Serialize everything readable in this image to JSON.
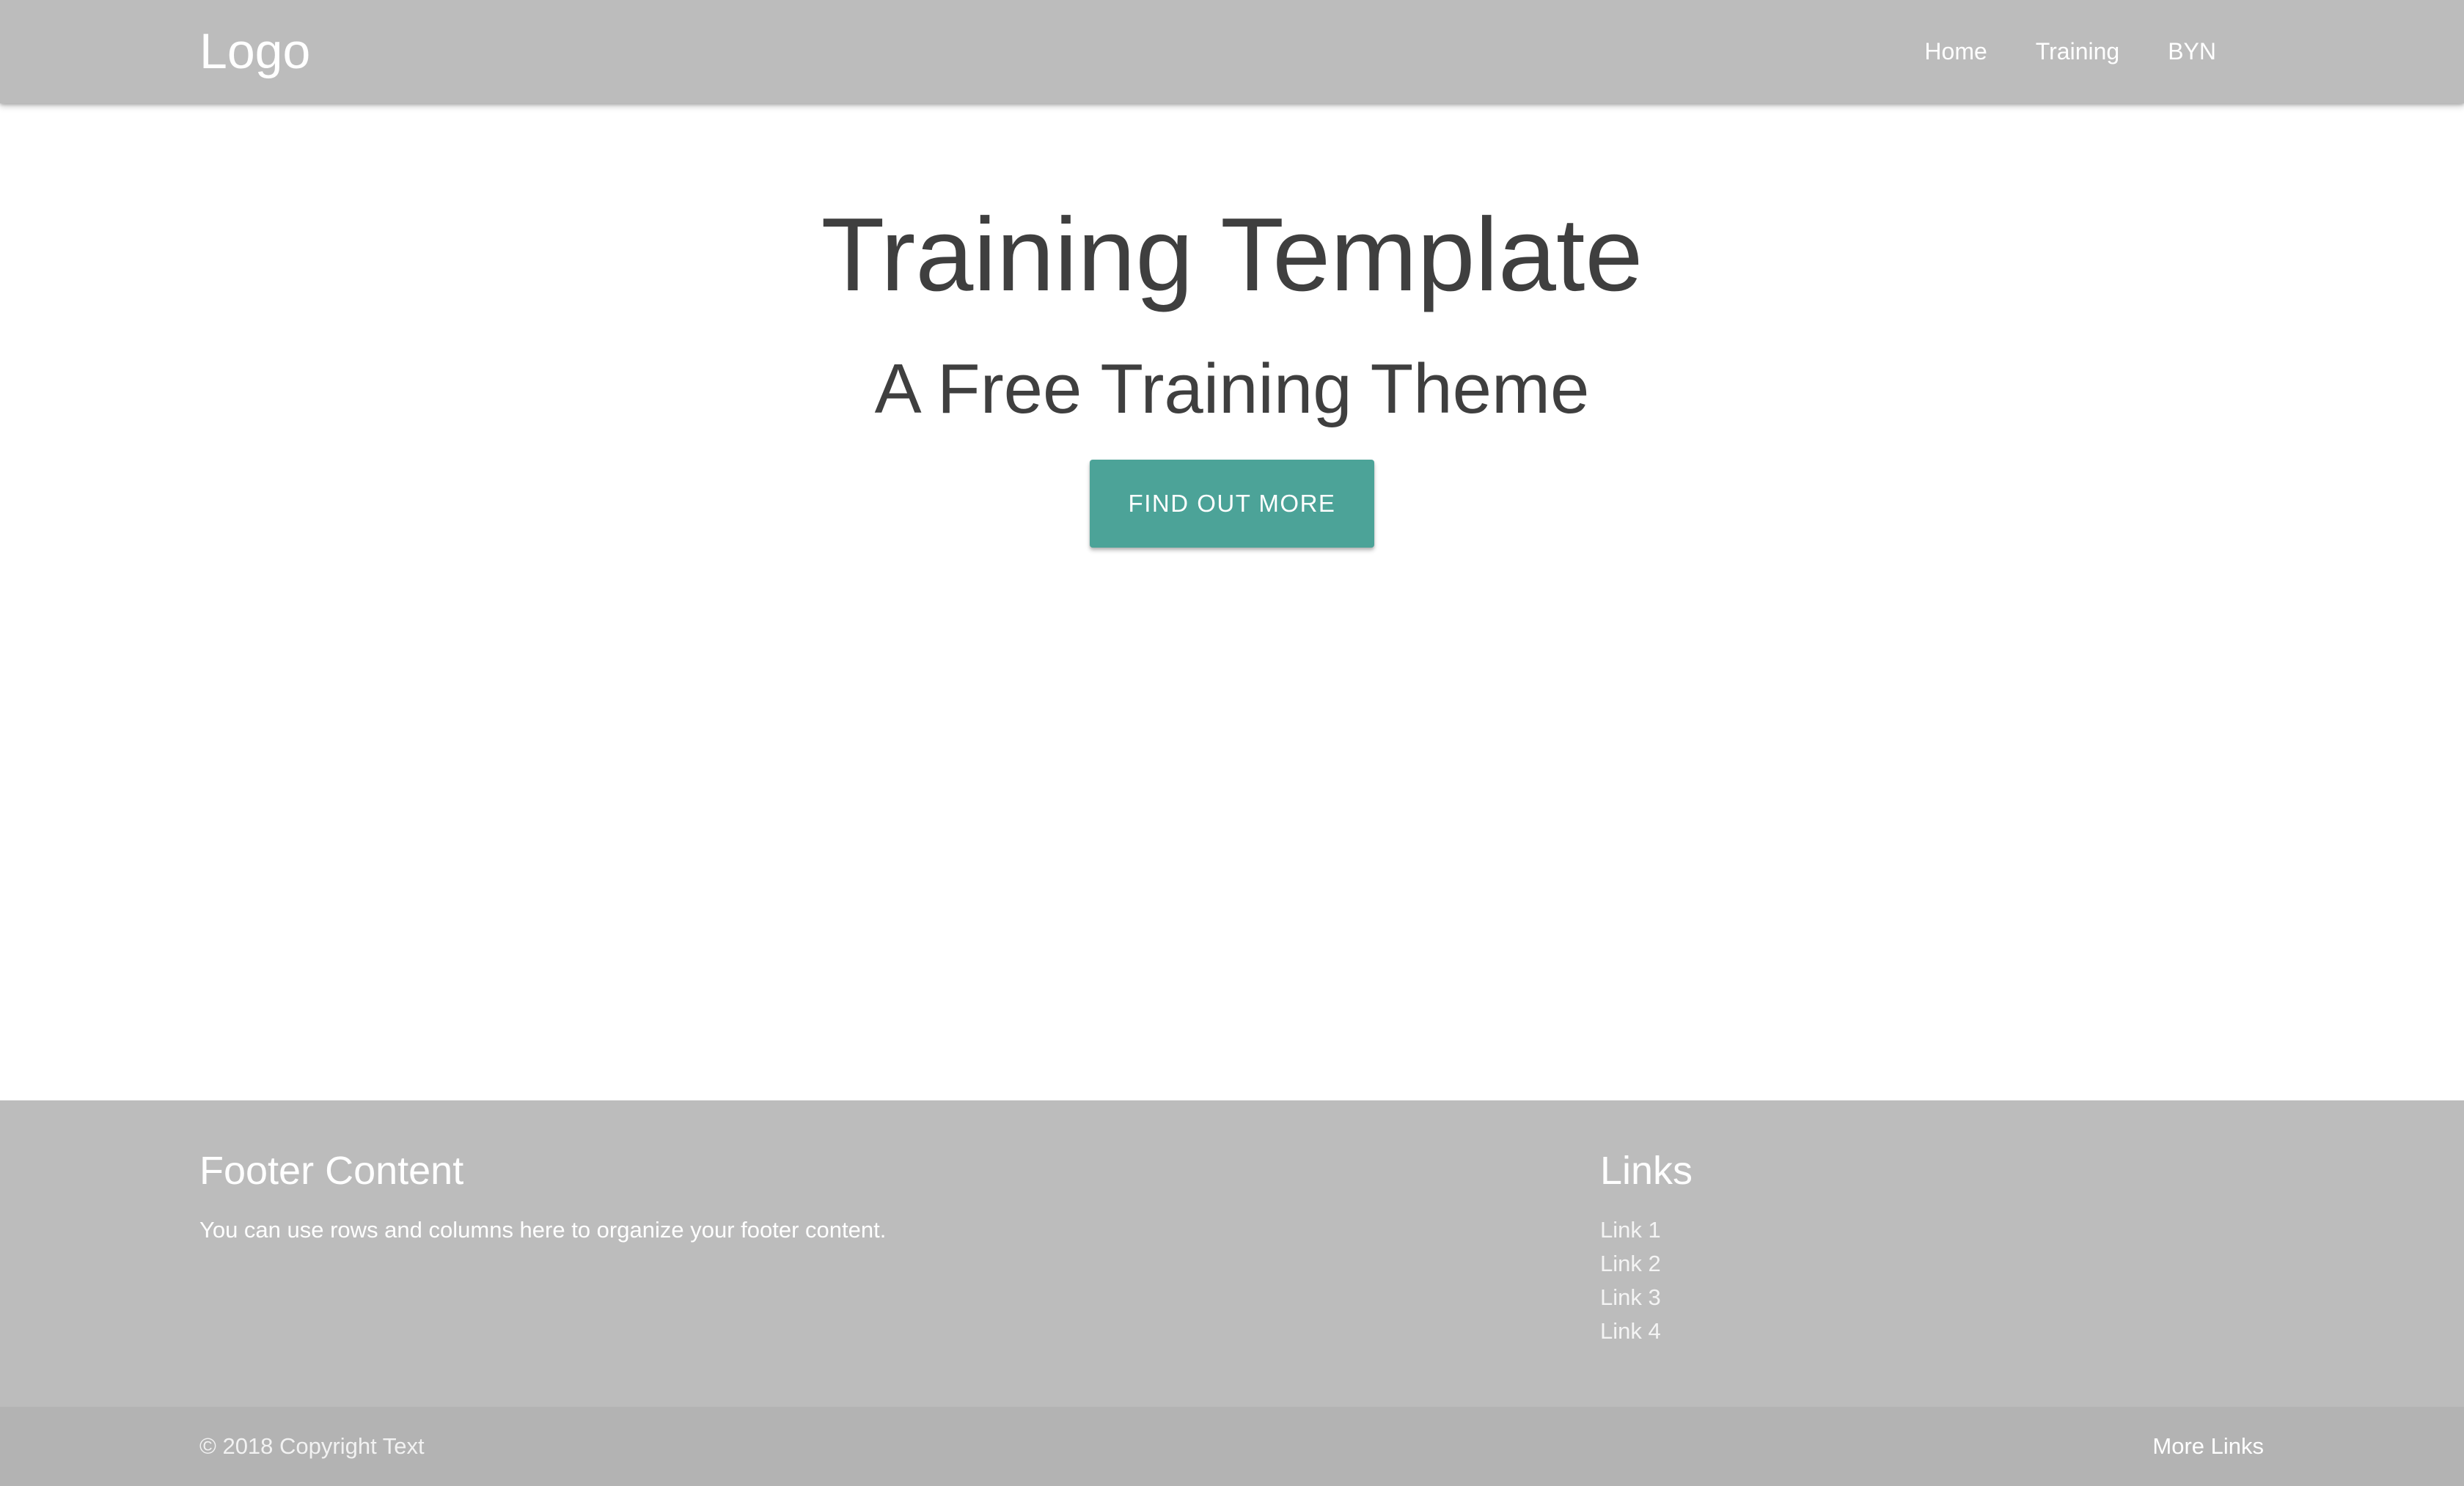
{
  "navbar": {
    "logo": "Logo",
    "links": [
      "Home",
      "Training",
      "BYN"
    ]
  },
  "hero": {
    "title": "Training Template",
    "subtitle": "A Free Training Theme",
    "cta_label": "FIND OUT MORE"
  },
  "footer": {
    "content_heading": "Footer Content",
    "content_text": "You can use rows and columns here to organize your footer content.",
    "links_heading": "Links",
    "links": [
      "Link 1",
      "Link 2",
      "Link 3",
      "Link 4"
    ]
  },
  "copyright": {
    "text": "© 2018 Copyright Text",
    "more_links": "More Links"
  },
  "colors": {
    "navbar_bg": "#bcbcbc",
    "accent": "#4ca398",
    "heading_text": "#3f3f3f",
    "footer_bg": "#bcbcbc",
    "copyright_bg": "#b3b3b3"
  }
}
